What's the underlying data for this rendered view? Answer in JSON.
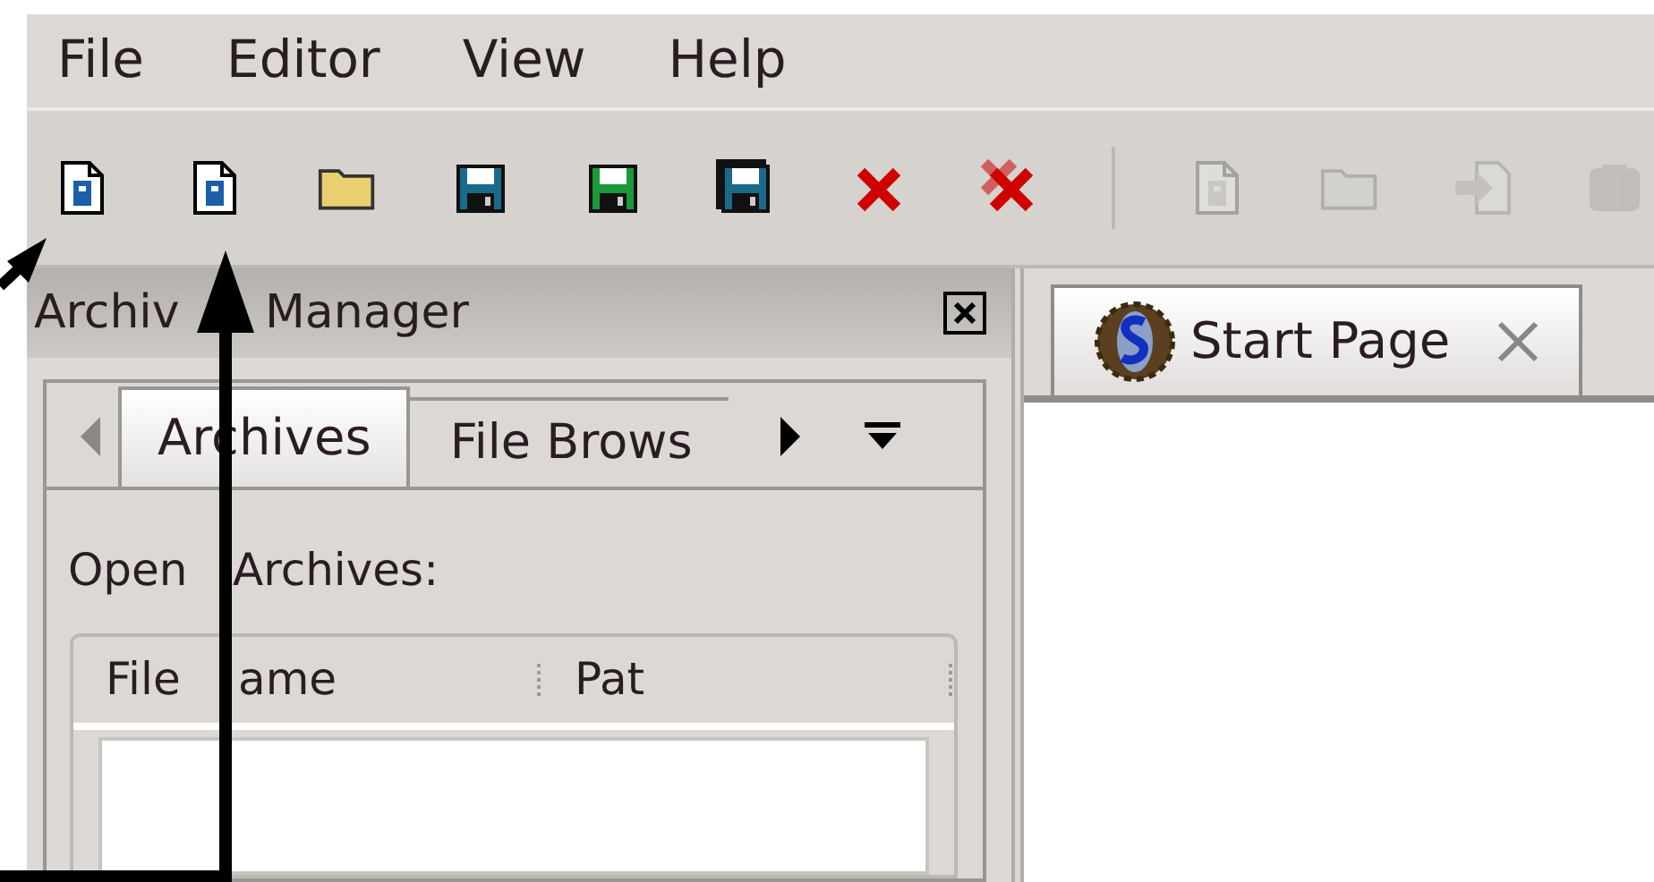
{
  "menu": [
    {
      "label": "File"
    },
    {
      "label": "Editor"
    },
    {
      "label": "View"
    },
    {
      "label": "Help"
    }
  ],
  "toolbar": [
    {
      "kind": "doc-a",
      "disabled": false
    },
    {
      "kind": "doc-z",
      "disabled": false
    },
    {
      "kind": "folder",
      "disabled": false
    },
    {
      "kind": "save-blue",
      "disabled": false
    },
    {
      "kind": "save-green",
      "disabled": false
    },
    {
      "kind": "save-all",
      "disabled": false
    },
    {
      "kind": "close",
      "disabled": false
    },
    {
      "kind": "close-all",
      "disabled": false
    },
    {
      "kind": "separator"
    },
    {
      "kind": "doc-e",
      "disabled": true
    },
    {
      "kind": "folder",
      "disabled": true
    },
    {
      "kind": "import",
      "disabled": true
    },
    {
      "kind": "texture",
      "disabled": true
    }
  ],
  "panel": {
    "title": [
      "Archiv",
      "Manager"
    ],
    "tabs": [
      {
        "label": "Archives",
        "selected": true
      },
      {
        "label": "File Brows",
        "selected": false
      }
    ],
    "label": [
      "Open",
      "Archives:"
    ],
    "columns": [
      [
        "File",
        "ame"
      ],
      [
        "Pat"
      ]
    ]
  },
  "document_tabs": [
    {
      "label": "Start Page",
      "selected": true
    }
  ]
}
